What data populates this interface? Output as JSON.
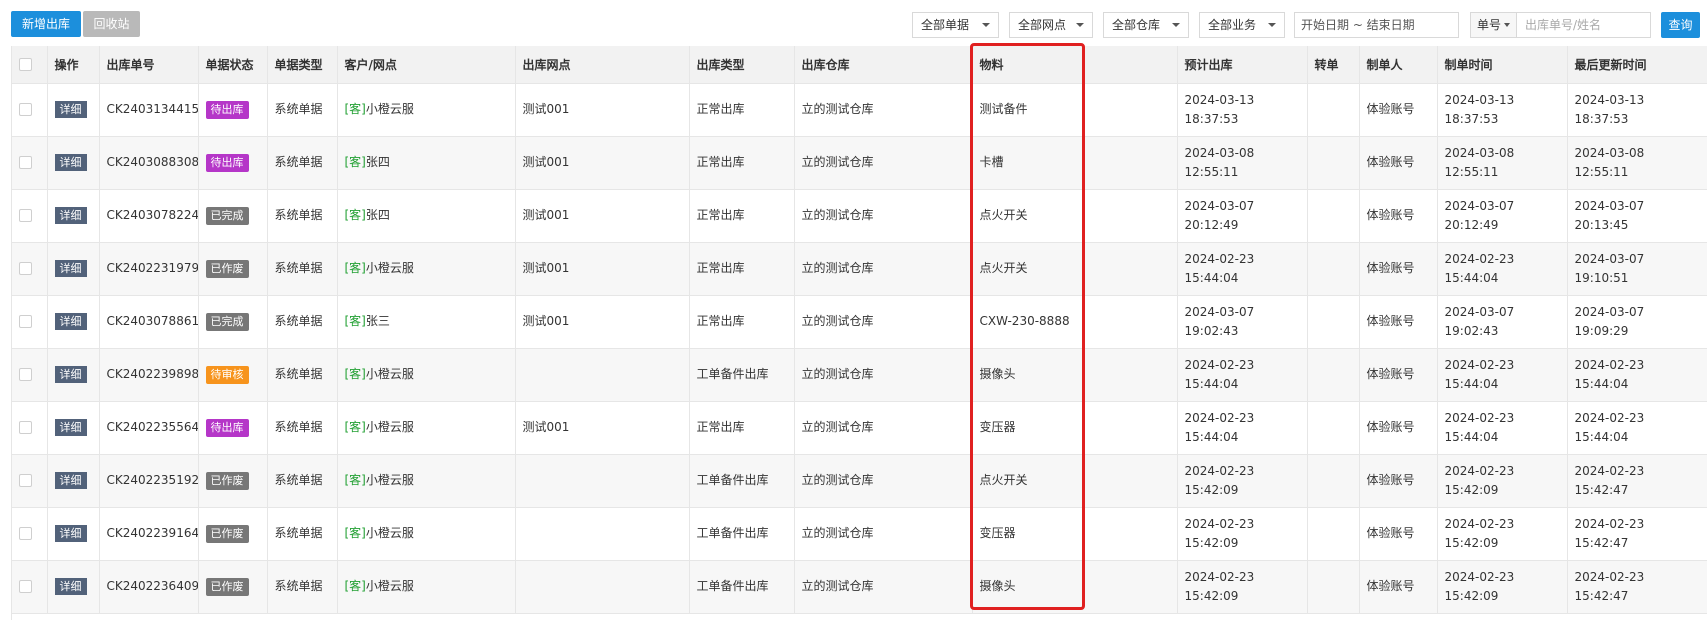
{
  "toolbar": {
    "new_outbound": "新增出库",
    "recycle_bin": "回收站",
    "filter_docs": "全部单据",
    "filter_sites": "全部网点",
    "filter_warehouses": "全部仓库",
    "filter_business": "全部业务",
    "date_range": "开始日期 ~ 结束日期",
    "search_type": "单号",
    "search_placeholder": "出库单号/姓名",
    "query": "查询"
  },
  "table": {
    "headers": [
      "操作",
      "出库单号",
      "单据状态",
      "单据类型",
      "客户/网点",
      "出库网点",
      "出库类型",
      "出库仓库",
      "物料",
      "预计出库",
      "转单",
      "制单人",
      "制单时间",
      "最后更新时间"
    ],
    "rows": [
      {
        "action": "详细",
        "order_no": "CK2403134415",
        "status": "待出库",
        "status_color": "#b536c8",
        "doc_type": "系统单据",
        "cust_tag": "[客]",
        "customer": "小橙云服",
        "site": "测试001",
        "out_type": "正常出库",
        "warehouse": "立的测试仓库",
        "material": "测试备件",
        "expected_date": "2024-03-13",
        "expected_time": "18:37:53",
        "transfer": "",
        "creator": "体验账号",
        "created_date": "2024-03-13",
        "created_time": "18:37:53",
        "updated_date": "2024-03-13",
        "updated_time": "18:37:53"
      },
      {
        "action": "详细",
        "order_no": "CK2403088308",
        "status": "待出库",
        "status_color": "#b536c8",
        "doc_type": "系统单据",
        "cust_tag": "[客]",
        "customer": "张四",
        "site": "测试001",
        "out_type": "正常出库",
        "warehouse": "立的测试仓库",
        "material": "卡槽",
        "expected_date": "2024-03-08",
        "expected_time": "12:55:11",
        "transfer": "",
        "creator": "体验账号",
        "created_date": "2024-03-08",
        "created_time": "12:55:11",
        "updated_date": "2024-03-08",
        "updated_time": "12:55:11"
      },
      {
        "action": "详细",
        "order_no": "CK2403078224",
        "status": "已完成",
        "status_color": "#777777",
        "doc_type": "系统单据",
        "cust_tag": "[客]",
        "customer": "张四",
        "site": "测试001",
        "out_type": "正常出库",
        "warehouse": "立的测试仓库",
        "material": "点火开关",
        "expected_date": "2024-03-07",
        "expected_time": "20:12:49",
        "transfer": "",
        "creator": "体验账号",
        "created_date": "2024-03-07",
        "created_time": "20:12:49",
        "updated_date": "2024-03-07",
        "updated_time": "20:13:45"
      },
      {
        "action": "详细",
        "order_no": "CK2402231979",
        "status": "已作废",
        "status_color": "#777777",
        "doc_type": "系统单据",
        "cust_tag": "[客]",
        "customer": "小橙云服",
        "site": "测试001",
        "out_type": "正常出库",
        "warehouse": "立的测试仓库",
        "material": "点火开关",
        "expected_date": "2024-02-23",
        "expected_time": "15:44:04",
        "transfer": "",
        "creator": "体验账号",
        "created_date": "2024-02-23",
        "created_time": "15:44:04",
        "updated_date": "2024-03-07",
        "updated_time": "19:10:51"
      },
      {
        "action": "详细",
        "order_no": "CK2403078861",
        "status": "已完成",
        "status_color": "#777777",
        "doc_type": "系统单据",
        "cust_tag": "[客]",
        "customer": "张三",
        "site": "测试001",
        "out_type": "正常出库",
        "warehouse": "立的测试仓库",
        "material": "CXW-230-8888",
        "expected_date": "2024-03-07",
        "expected_time": "19:02:43",
        "transfer": "",
        "creator": "体验账号",
        "created_date": "2024-03-07",
        "created_time": "19:02:43",
        "updated_date": "2024-03-07",
        "updated_time": "19:09:29"
      },
      {
        "action": "详细",
        "order_no": "CK2402239898",
        "status": "待审核",
        "status_color": "#f7941d",
        "doc_type": "系统单据",
        "cust_tag": "[客]",
        "customer": "小橙云服",
        "site": "",
        "out_type": "工单备件出库",
        "warehouse": "立的测试仓库",
        "material": "摄像头",
        "expected_date": "2024-02-23",
        "expected_time": "15:44:04",
        "transfer": "",
        "creator": "体验账号",
        "created_date": "2024-02-23",
        "created_time": "15:44:04",
        "updated_date": "2024-02-23",
        "updated_time": "15:44:04"
      },
      {
        "action": "详细",
        "order_no": "CK2402235564",
        "status": "待出库",
        "status_color": "#b536c8",
        "doc_type": "系统单据",
        "cust_tag": "[客]",
        "customer": "小橙云服",
        "site": "测试001",
        "out_type": "正常出库",
        "warehouse": "立的测试仓库",
        "material": "变压器",
        "expected_date": "2024-02-23",
        "expected_time": "15:44:04",
        "transfer": "",
        "creator": "体验账号",
        "created_date": "2024-02-23",
        "created_time": "15:44:04",
        "updated_date": "2024-02-23",
        "updated_time": "15:44:04"
      },
      {
        "action": "详细",
        "order_no": "CK2402235192",
        "status": "已作废",
        "status_color": "#777777",
        "doc_type": "系统单据",
        "cust_tag": "[客]",
        "customer": "小橙云服",
        "site": "",
        "out_type": "工单备件出库",
        "warehouse": "立的测试仓库",
        "material": "点火开关",
        "expected_date": "2024-02-23",
        "expected_time": "15:42:09",
        "transfer": "",
        "creator": "体验账号",
        "created_date": "2024-02-23",
        "created_time": "15:42:09",
        "updated_date": "2024-02-23",
        "updated_time": "15:42:47"
      },
      {
        "action": "详细",
        "order_no": "CK2402239164",
        "status": "已作废",
        "status_color": "#777777",
        "doc_type": "系统单据",
        "cust_tag": "[客]",
        "customer": "小橙云服",
        "site": "",
        "out_type": "工单备件出库",
        "warehouse": "立的测试仓库",
        "material": "变压器",
        "expected_date": "2024-02-23",
        "expected_time": "15:42:09",
        "transfer": "",
        "creator": "体验账号",
        "created_date": "2024-02-23",
        "created_time": "15:42:09",
        "updated_date": "2024-02-23",
        "updated_time": "15:42:47"
      },
      {
        "action": "详细",
        "order_no": "CK2402236409",
        "status": "已作废",
        "status_color": "#777777",
        "doc_type": "系统单据",
        "cust_tag": "[客]",
        "customer": "小橙云服",
        "site": "",
        "out_type": "工单备件出库",
        "warehouse": "立的测试仓库",
        "material": "摄像头",
        "expected_date": "2024-02-23",
        "expected_time": "15:42:09",
        "transfer": "",
        "creator": "体验账号",
        "created_date": "2024-02-23",
        "created_time": "15:42:09",
        "updated_date": "2024-02-23",
        "updated_time": "15:42:47"
      }
    ]
  },
  "colors": {
    "primary": "#1c8fdc",
    "highlight_border": "#e02020",
    "customer_tag": "#22a033",
    "detail_button": "#52627a"
  }
}
